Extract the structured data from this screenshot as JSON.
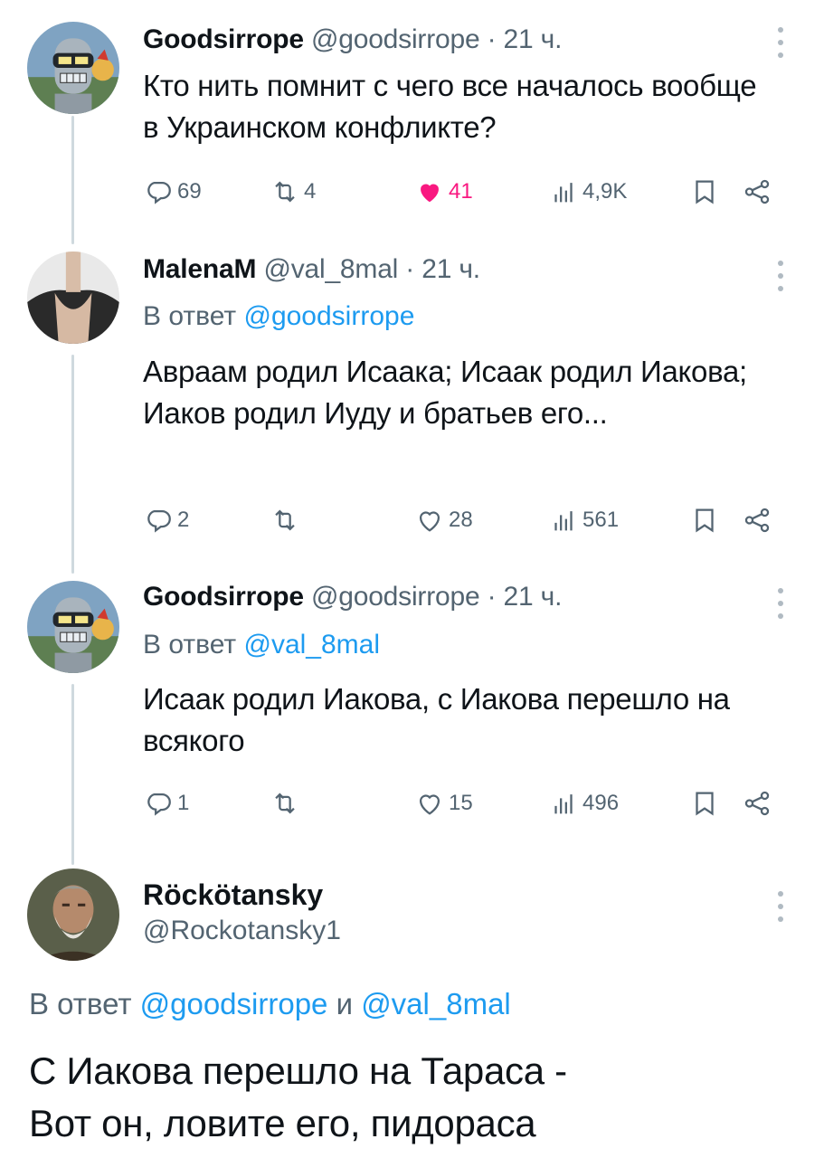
{
  "tweets": [
    {
      "name": "Goodsirrope",
      "handle": "@goodsirrope",
      "dot": "·",
      "time": "21 ч.",
      "text": "Кто нить помнит с чего все началось вообще в Украинском конфликте?",
      "replies": "69",
      "retweets": "4",
      "likes": "41",
      "liked": true,
      "views": "4,9K",
      "avatar_icon": "robot-avatar"
    },
    {
      "name": "MalenaM",
      "handle": "@val_8mal",
      "dot": "·",
      "time": "21 ч.",
      "reply_prefix": "В ответ ",
      "reply_mention": "@goodsirrope",
      "text": "Авраам родил Исаака; Исаак родил Иакова; Иаков родил Иуду и братьев его...",
      "replies": "2",
      "retweets": "",
      "likes": "28",
      "liked": false,
      "views": "561",
      "avatar_icon": "person-avatar"
    },
    {
      "name": "Goodsirrope",
      "handle": "@goodsirrope",
      "dot": "·",
      "time": "21 ч.",
      "reply_prefix": "В ответ ",
      "reply_mention": "@val_8mal",
      "text": "Исаак родил Иакова, с Иакова перешло на всякого",
      "replies": "1",
      "retweets": "",
      "likes": "15",
      "liked": false,
      "views": "496",
      "avatar_icon": "robot-avatar"
    }
  ],
  "main_tweet": {
    "name": "Röckötansky",
    "handle": "@Rockotansky1",
    "reply_prefix": "В ответ ",
    "reply_mention_1": "@goodsirrope",
    "reply_joiner": " и ",
    "reply_mention_2": "@val_8mal",
    "text_line_1": "С Иакова перешло на Тараса -",
    "text_line_2": "Вот он, ловите его, пидораса",
    "avatar_icon": "bearded-man-avatar"
  },
  "colors": {
    "accent": "#1d9bf0",
    "like": "#f91880",
    "muted": "#536471",
    "thread_line": "#cfd9de"
  }
}
